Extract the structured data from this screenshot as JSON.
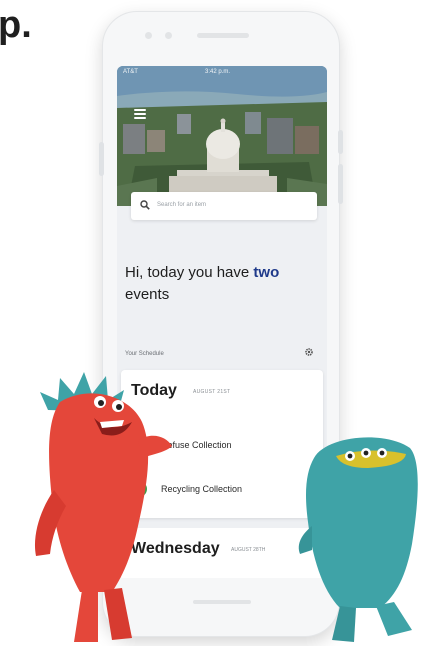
{
  "headline": "p.",
  "colors": {
    "accent": "#1f3a8a",
    "refuse_ring": "#d8b23a",
    "recycling_ring": "#3f9b4a",
    "red_monster": "#e4473a",
    "teal_monster": "#3fa3a7"
  },
  "app": {
    "statusbar": {
      "carrier": "AT&T",
      "time": "3:42 p.m."
    },
    "menu_icon": "hamburger-menu-icon",
    "search": {
      "placeholder": "Search for an item",
      "icon": "search-icon"
    },
    "greeting": {
      "prefix": "Hi, today you have ",
      "count": "two",
      "suffix": " events"
    },
    "schedule": {
      "label": "Your Schedule",
      "settings_icon": "gear-icon"
    },
    "days": [
      {
        "title": "Today",
        "date": "AUGUST 21ST",
        "tasks": [
          {
            "label": "Refuse Collection",
            "icon": "ring-icon"
          },
          {
            "label": "Recycling Collection",
            "icon": "ring-icon"
          }
        ]
      },
      {
        "title": "Wednesday",
        "date": "AUGUST 28TH",
        "tasks": []
      }
    ]
  }
}
